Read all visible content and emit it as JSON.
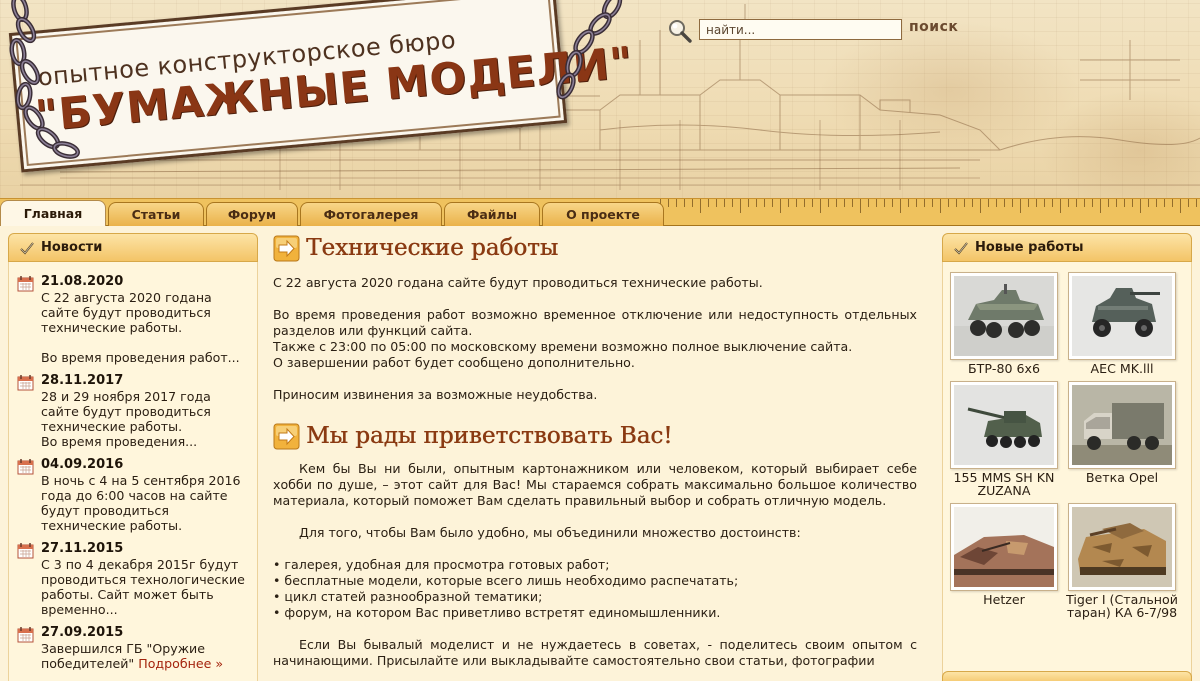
{
  "header": {
    "logo_line1": "опытное конструкторское бюро",
    "logo_line2": "\"БУМАЖНЫЕ МОДЕЛИ\"",
    "search_placeholder": "найти...",
    "search_button": "поиск"
  },
  "nav": {
    "tabs": [
      "Главная",
      "Статьи",
      "Форум",
      "Фотогалерея",
      "Файлы",
      "О проекте"
    ],
    "active": "Главная"
  },
  "news": {
    "title": "Новости",
    "items": [
      {
        "date": "21.08.2020",
        "text": "С 22 августа 2020 годана\nсайте будут проводиться\nтехнические работы.\n\nВо время проведения работ..."
      },
      {
        "date": "28.11.2017",
        "text": "28 и 29 ноября 2017 года\nсайте будут проводиться\nтехнические работы.\nВо время проведения..."
      },
      {
        "date": "04.09.2016",
        "text": "В ночь с 4 на 5 сентября 2016\nгода до 6:00 часов на сайте\nбудут проводиться\nтехнические работы."
      },
      {
        "date": "27.11.2015",
        "text": "С 3 по 4 декабря 2015г будут\nпроводиться технологические\nработы. Сайт может быть\nвременно..."
      },
      {
        "date": "27.09.2015",
        "text": "Завершился ГБ \"Оружие\nпобедителей\"",
        "more": "Подробнее »"
      }
    ]
  },
  "main": {
    "article1": {
      "title": "Технические работы",
      "p1": "С 22 августа 2020 годана сайте будут проводиться технические работы.",
      "p2": "Во время проведения работ возможно временное отключение или недоступность отдельных разделов или функций сайта.\nТакже с 23:00 по 05:00 по московскому времени возможно полное выключение сайта.\nО завершении работ будет сообщено дополнительно.",
      "p3": "Приносим извинения за возможные неудобства."
    },
    "article2": {
      "title": "Мы рады приветствовать Вас!",
      "p1": "Кем бы Вы ни были, опытным картонажником или человеком, который выбирает себе хобби по душе, – этот сайт для Вас! Мы стараемся собрать максимально большое количество материала, который поможет Вам сделать правильный выбор и собрать отличную модель.",
      "p2": "Для того, чтобы Вам было удобно, мы объединили множество достоинств:",
      "list": [
        "• галерея, удобная для просмотра готовых работ;",
        "• бесплатные модели, которые всего лишь необходимо распечатать;",
        "• цикл статей разнообразной тематики;",
        "• форум, на котором Вас приветливо встретят единомышленники."
      ],
      "p3": "Если Вы бывалый моделист и не нуждаетесь в советах, - поделитесь своим опытом с начинающими. Присылайте или выкладывайте самостоятельно свои статьи, фотографии"
    }
  },
  "new_works": {
    "title": "Новые работы",
    "items": [
      {
        "caption": "БТР-80 6x6",
        "icon": "armored-car-photo"
      },
      {
        "caption": "AEC MK.lll",
        "icon": "armored-car-photo"
      },
      {
        "caption": "155 MMS SH KN ZUZANA",
        "icon": "howitzer-photo"
      },
      {
        "caption": "Ветка Opel",
        "icon": "truck-photo"
      },
      {
        "caption": "Hetzer",
        "icon": "tank-destroyer-photo"
      },
      {
        "caption": "Tiger I (Стальной таран) КА 6-7/98",
        "icon": "tank-photo"
      }
    ]
  },
  "colors": {
    "accent_title": "#8a3a12",
    "tab_bg": "#eab24a",
    "panel_head": "#f3c467",
    "link": "#a4240d"
  }
}
